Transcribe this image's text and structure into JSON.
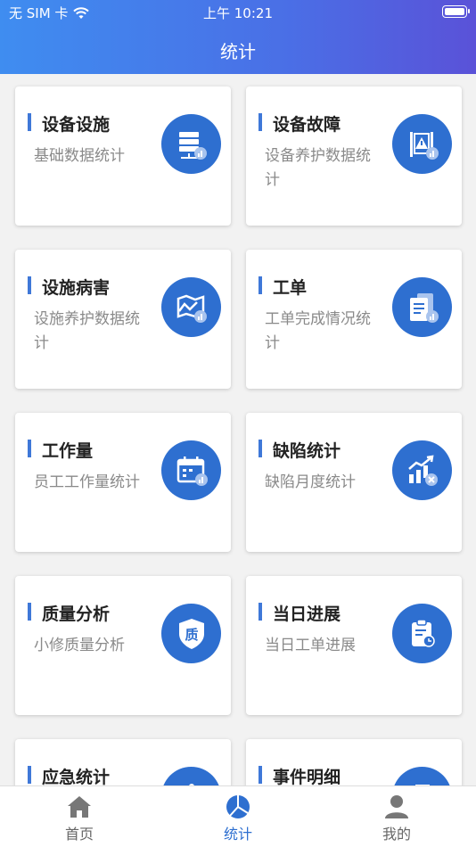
{
  "status_bar": {
    "carrier": "无 SIM 卡",
    "time": "上午 10:21"
  },
  "nav": {
    "title": "统计"
  },
  "cards": [
    {
      "title": "设备设施",
      "subtitle": "基础数据统计",
      "icon": "server-chart-icon"
    },
    {
      "title": "设备故障",
      "subtitle": "设备养护数据统计",
      "icon": "warning-chart-icon"
    },
    {
      "title": "设施病害",
      "subtitle": "设施养护数据统计",
      "icon": "map-chart-icon"
    },
    {
      "title": "工单",
      "subtitle": "工单完成情况统计",
      "icon": "documents-chart-icon"
    },
    {
      "title": "工作量",
      "subtitle": "员工工作量统计",
      "icon": "calendar-chart-icon"
    },
    {
      "title": "缺陷统计",
      "subtitle": "缺陷月度统计",
      "icon": "bar-trend-icon"
    },
    {
      "title": "质量分析",
      "subtitle": "小修质量分析",
      "icon": "quality-shield-icon",
      "icon_text": "质"
    },
    {
      "title": "当日进展",
      "subtitle": "当日工单进展",
      "icon": "clipboard-clock-icon"
    },
    {
      "title": "应急统计",
      "subtitle": "",
      "icon": "emergency-icon"
    },
    {
      "title": "事件明细",
      "subtitle": "",
      "icon": "event-detail-icon"
    }
  ],
  "tabbar": [
    {
      "label": "首页",
      "icon": "home-icon",
      "active": false
    },
    {
      "label": "统计",
      "icon": "pie-chart-icon",
      "active": true
    },
    {
      "label": "我的",
      "icon": "user-icon",
      "active": false
    }
  ],
  "colors": {
    "accent": "#2e6fd0",
    "header_start": "#3f8df0",
    "header_end": "#5a52d8"
  }
}
